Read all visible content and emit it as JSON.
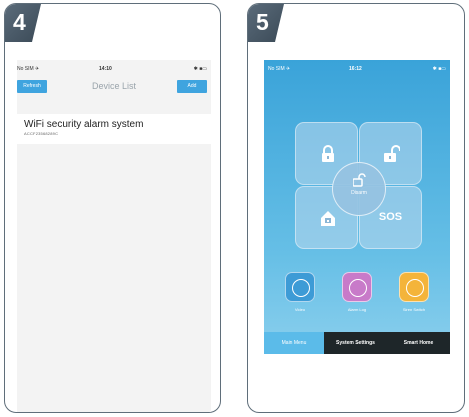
{
  "step_left": "4",
  "step_right": "5",
  "device_list_screen": {
    "status": {
      "carrier": "No SIM ✈",
      "time": "14:10",
      "battery": "✱ ■▭"
    },
    "nav": {
      "left_button": "Refresh",
      "title": "Device List",
      "right_button": "Add"
    },
    "items": [
      {
        "name": "WiFi security alarm system",
        "id": "ACCF23568289C"
      }
    ]
  },
  "main_menu_screen": {
    "status": {
      "carrier": "No SIM ✈",
      "time": "16:12",
      "battery": "✱ ■▭"
    },
    "tiles": {
      "arm_icon": "lock-icon",
      "disarm_icon": "unlock-icon",
      "home_icon": "home-icon",
      "sos_label": "SOS"
    },
    "center": {
      "icon": "small-unlock-icon",
      "label": "Disarm"
    },
    "apps": [
      {
        "label": "Video",
        "icon": "camera-icon",
        "color": "#3d9bd6"
      },
      {
        "label": "Alarm Log",
        "icon": "log-icon",
        "color": "#c87ac9"
      },
      {
        "label": "Siren Switch",
        "icon": "speaker-icon",
        "color": "#f4b43a"
      }
    ],
    "tabs": [
      "Main Menu",
      "System Settings",
      "Smart Home"
    ],
    "active_tab": "Main Menu"
  }
}
